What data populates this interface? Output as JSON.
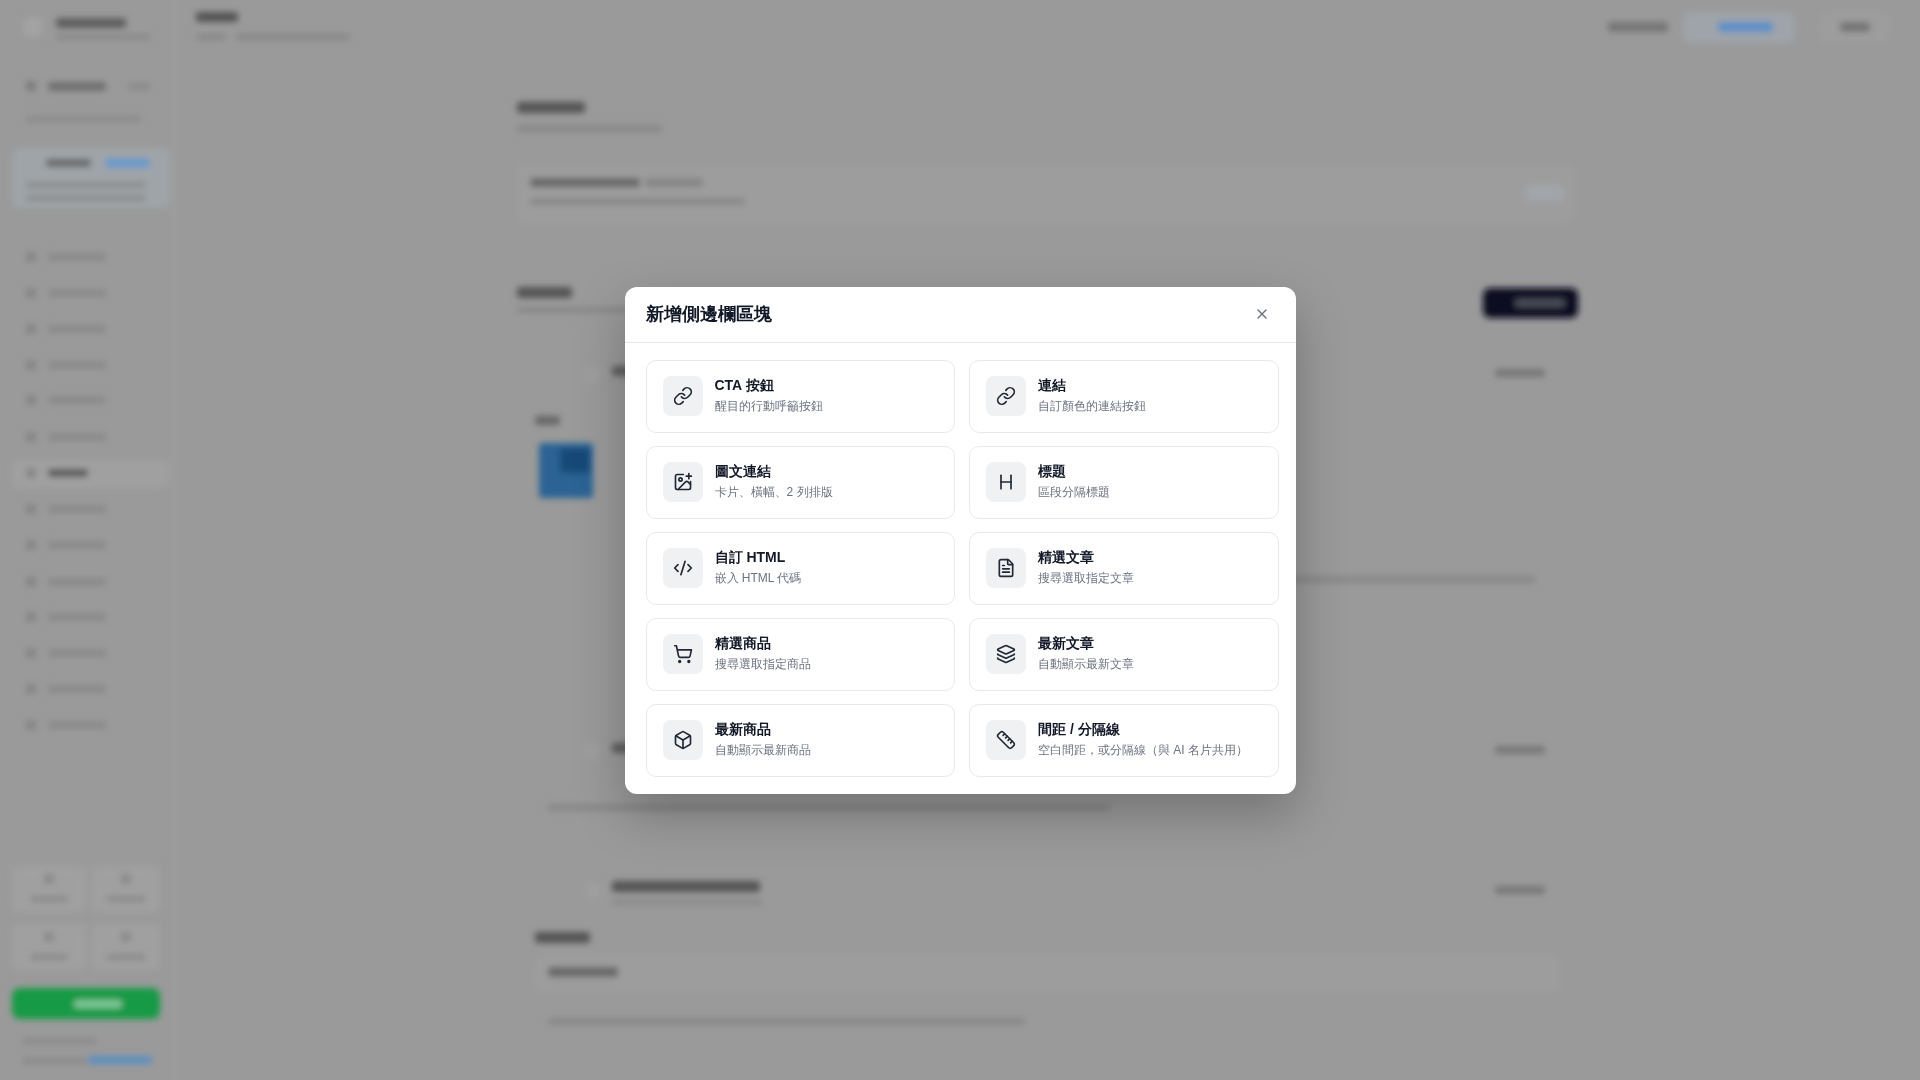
{
  "dialog": {
    "title": "新增側邊欄區塊",
    "blocks": [
      {
        "kind": "cta",
        "title": "CTA 按鈕",
        "description": "醒目的行動呼籲按鈕"
      },
      {
        "kind": "link",
        "title": "連結",
        "description": "自訂顏色的連結按鈕"
      },
      {
        "kind": "imagelink",
        "title": "圖文連結",
        "description": "卡片、橫幅、2 列排版"
      },
      {
        "kind": "heading",
        "title": "標題",
        "description": "區段分隔標題"
      },
      {
        "kind": "html",
        "title": "自訂 HTML",
        "description": "嵌入 HTML 代碼"
      },
      {
        "kind": "article",
        "title": "精選文章",
        "description": "搜尋選取指定文章"
      },
      {
        "kind": "product",
        "title": "精選商品",
        "description": "搜尋選取指定商品"
      },
      {
        "kind": "feed",
        "title": "最新文章",
        "description": "自動顯示最新文章"
      },
      {
        "kind": "catalog",
        "title": "最新商品",
        "description": "自動顯示最新商品"
      },
      {
        "kind": "spacer",
        "title": "間距 / 分隔線",
        "description": "空白間距，或分隔線（與 AI 名片共用）"
      }
    ]
  }
}
